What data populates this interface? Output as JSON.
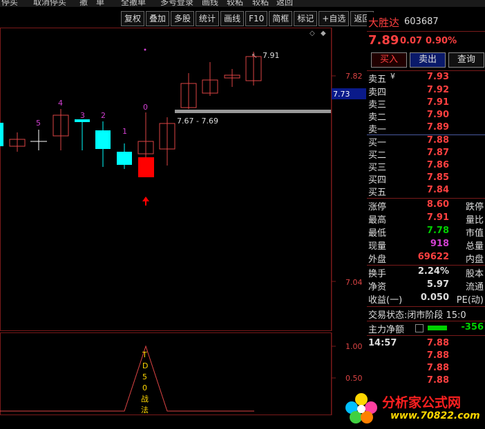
{
  "topbar": {
    "items": [
      "停买",
      "取消停买",
      "撤　单",
      "全撤单",
      "多号登录",
      "画线",
      "较粘",
      "较粘",
      "返回"
    ]
  },
  "toolbar": {
    "items": [
      "复权",
      "叠加",
      "多股",
      "统计",
      "画线",
      "F10",
      "简框",
      "标记",
      "+自选",
      "返回"
    ]
  },
  "stock": {
    "name": "大胜达",
    "code": "603687",
    "price": "7.89",
    "change": "0.07",
    "change_pct": "0.90%"
  },
  "actions": {
    "buy": "买入",
    "sell": "卖出",
    "query": "查询"
  },
  "sell_orders": [
    {
      "label": "卖五",
      "price": "7.93"
    },
    {
      "label": "卖四",
      "price": "7.92"
    },
    {
      "label": "卖三",
      "price": "7.91"
    },
    {
      "label": "卖二",
      "price": "7.90"
    },
    {
      "label": "卖一",
      "price": "7.89"
    }
  ],
  "buy_orders": [
    {
      "label": "买一",
      "price": "7.88"
    },
    {
      "label": "买二",
      "price": "7.87"
    },
    {
      "label": "买三",
      "price": "7.86"
    },
    {
      "label": "买四",
      "price": "7.85"
    },
    {
      "label": "买五",
      "price": "7.84"
    }
  ],
  "stats": [
    {
      "label": "涨停",
      "value": "8.60",
      "label2": "跌停",
      "color": "red"
    },
    {
      "label": "最高",
      "value": "7.91",
      "label2": "量比",
      "color": "red"
    },
    {
      "label": "最低",
      "value": "7.78",
      "label2": "市值",
      "color": "green"
    },
    {
      "label": "现量",
      "value": "918",
      "label2": "总量",
      "color": "purple"
    },
    {
      "label": "外盘",
      "value": "69622",
      "label2": "内盘",
      "color": "red"
    }
  ],
  "stats2": [
    {
      "label": "换手",
      "value": "2.24%",
      "label2": "股本"
    },
    {
      "label": "净资",
      "value": "5.97",
      "label2": "流通"
    },
    {
      "label": "收益(一)",
      "value": "0.050",
      "label2": "PE(动)"
    }
  ],
  "trade_status": "交易状态:闭市阶段 15:0",
  "main_flow": {
    "label": "主力净额",
    "value": "-356"
  },
  "ticks": {
    "time": "14:57",
    "prices": [
      "7.88",
      "7.88",
      "7.88",
      "7.88"
    ]
  },
  "chart": {
    "price_axis": [
      "7.82",
      "7.73",
      "7.04"
    ],
    "current_price_tag": "7.73",
    "high_label": "7.91",
    "range_label": "7.67 - 7.69",
    "counts": [
      "5",
      "4",
      "3",
      "2",
      "1",
      "0"
    ],
    "sub_axis": [
      "1.00",
      "0.50"
    ],
    "td_label": [
      "T",
      "D",
      "5",
      "0",
      "战",
      "法"
    ]
  },
  "watermark": {
    "title": "分析家公式网",
    "url": "www.70822.com"
  },
  "colors": {
    "up": "#ff4040",
    "down_fill": "#00ffff",
    "signal": "#ff0000",
    "count": "#d040d0"
  }
}
